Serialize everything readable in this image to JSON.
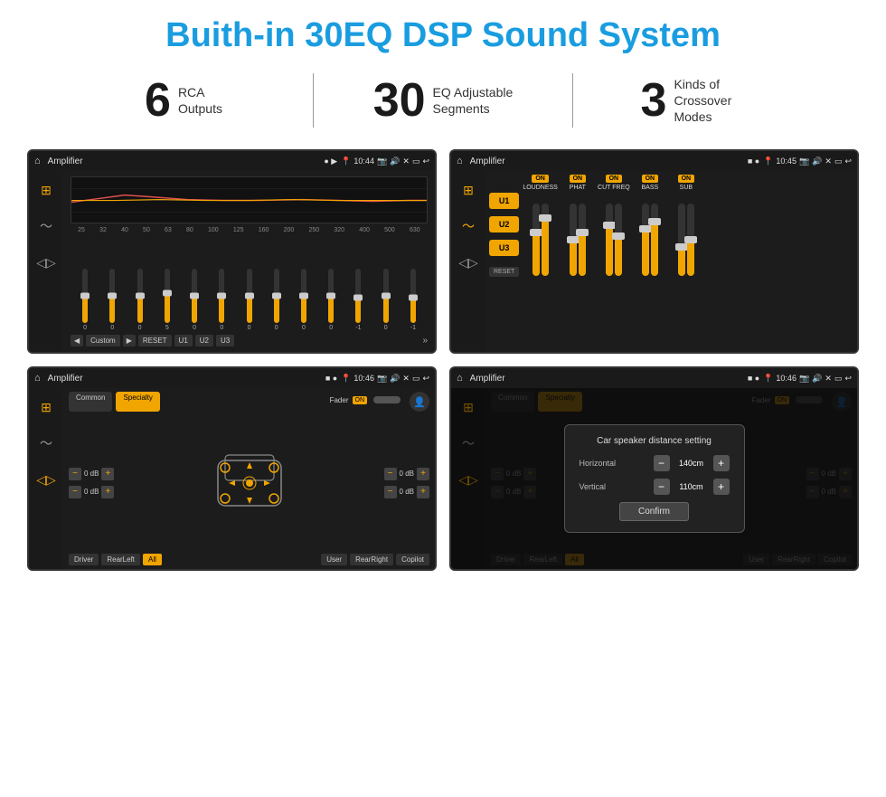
{
  "header": {
    "title": "Buith-in 30EQ DSP Sound System"
  },
  "stats": [
    {
      "number": "6",
      "text": "RCA\nOutputs"
    },
    {
      "number": "30",
      "text": "EQ Adjustable\nSegments"
    },
    {
      "number": "3",
      "text": "Kinds of\nCrossover Modes"
    }
  ],
  "screens": [
    {
      "id": "screen1",
      "statusBar": {
        "title": "Amplifier",
        "time": "10:44"
      },
      "type": "eq",
      "freqLabels": [
        "25",
        "32",
        "40",
        "50",
        "63",
        "80",
        "100",
        "125",
        "160",
        "200",
        "250",
        "320",
        "400",
        "500",
        "630"
      ],
      "sliderValues": [
        "0",
        "0",
        "0",
        "5",
        "0",
        "0",
        "0",
        "0",
        "0",
        "0",
        "-1",
        "0",
        "-1"
      ],
      "bottomButtons": [
        "Custom",
        "RESET",
        "U1",
        "U2",
        "U3"
      ]
    },
    {
      "id": "screen2",
      "statusBar": {
        "title": "Amplifier",
        "time": "10:45"
      },
      "type": "crossover",
      "uButtons": [
        "U1",
        "U2",
        "U3"
      ],
      "channels": [
        {
          "label": "ON",
          "name": "LOUDNESS"
        },
        {
          "label": "ON",
          "name": "PHAT"
        },
        {
          "label": "ON",
          "name": "CUT FREQ"
        },
        {
          "label": "ON",
          "name": "BASS"
        },
        {
          "label": "ON",
          "name": "SUB"
        }
      ],
      "resetLabel": "RESET"
    },
    {
      "id": "screen3",
      "statusBar": {
        "title": "Amplifier",
        "time": "10:46"
      },
      "type": "speaker",
      "tabs": [
        "Common",
        "Specialty"
      ],
      "faderLabel": "Fader",
      "onLabel": "ON",
      "dbValues": [
        "0 dB",
        "0 dB",
        "0 dB",
        "0 dB"
      ],
      "bottomButtons": [
        "Driver",
        "RearLeft",
        "All",
        "User",
        "RearRight",
        "Copilot"
      ]
    },
    {
      "id": "screen4",
      "statusBar": {
        "title": "Amplifier",
        "time": "10:46"
      },
      "type": "speaker-dialog",
      "tabs": [
        "Common",
        "Specialty"
      ],
      "dialog": {
        "title": "Car speaker distance setting",
        "rows": [
          {
            "label": "Horizontal",
            "value": "140cm"
          },
          {
            "label": "Vertical",
            "value": "110cm"
          }
        ],
        "confirmLabel": "Confirm"
      }
    }
  ]
}
